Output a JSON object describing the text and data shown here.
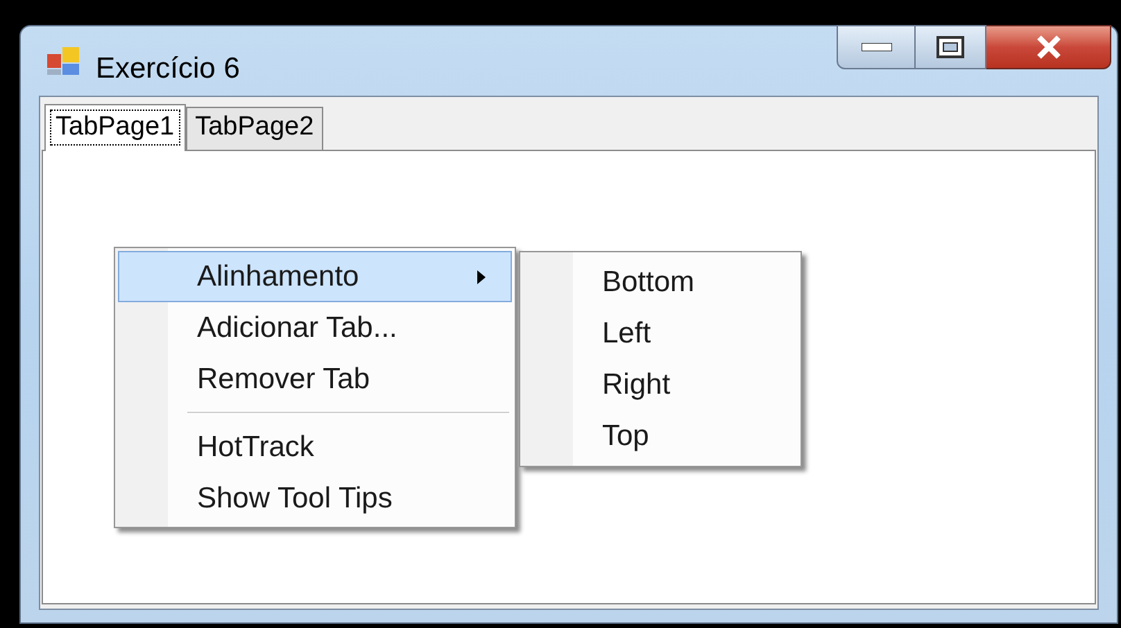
{
  "window": {
    "title": "Exercício 6"
  },
  "tabs": [
    {
      "label": "TabPage1",
      "selected": true
    },
    {
      "label": "TabPage2",
      "selected": false
    }
  ],
  "context_menu": {
    "items": [
      {
        "kind": "submenu",
        "label": "Alinhamento",
        "selected": true
      },
      {
        "kind": "item",
        "label": "Adicionar Tab...",
        "selected": false
      },
      {
        "kind": "item",
        "label": "Remover Tab",
        "selected": false
      },
      {
        "kind": "separator"
      },
      {
        "kind": "item",
        "label": "HotTrack",
        "selected": false
      },
      {
        "kind": "item",
        "label": "Show Tool Tips",
        "selected": false
      }
    ]
  },
  "submenu": {
    "items": [
      {
        "kind": "item",
        "label": "Bottom",
        "selected": false
      },
      {
        "kind": "item",
        "label": "Left",
        "selected": false
      },
      {
        "kind": "item",
        "label": "Right",
        "selected": false
      },
      {
        "kind": "item",
        "label": "Top",
        "selected": false
      }
    ]
  }
}
